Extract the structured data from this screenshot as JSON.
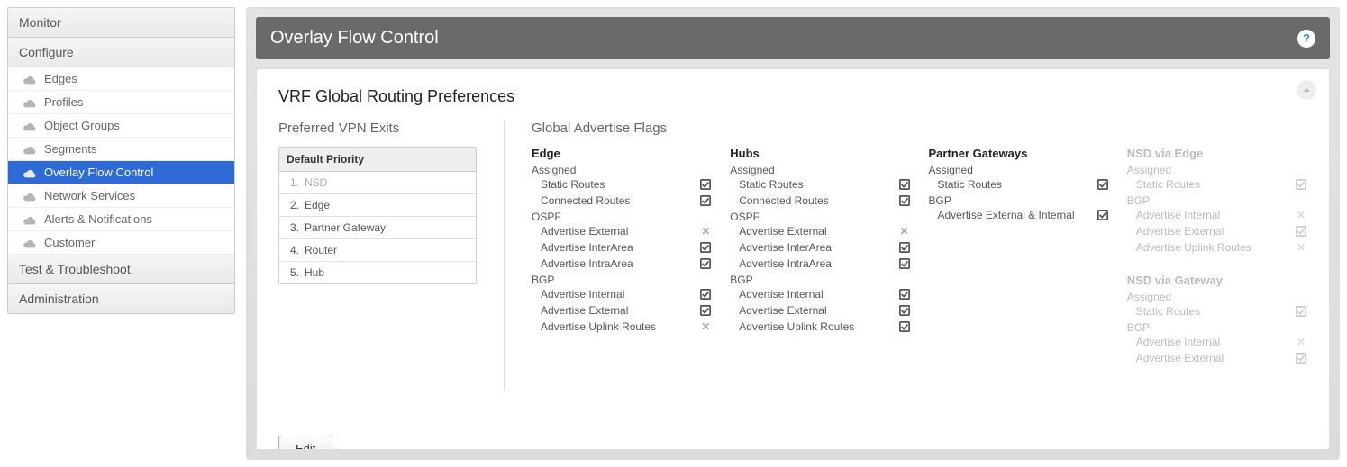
{
  "sidebar": {
    "sections": [
      {
        "label": "Monitor",
        "items": []
      },
      {
        "label": "Configure",
        "items": [
          {
            "label": "Edges"
          },
          {
            "label": "Profiles"
          },
          {
            "label": "Object Groups"
          },
          {
            "label": "Segments"
          },
          {
            "label": "Overlay Flow Control",
            "active": true
          },
          {
            "label": "Network Services"
          },
          {
            "label": "Alerts & Notifications"
          },
          {
            "label": "Customer"
          }
        ]
      },
      {
        "label": "Test & Troubleshoot",
        "items": []
      },
      {
        "label": "Administration",
        "items": []
      }
    ]
  },
  "header": {
    "title": "Overlay Flow Control",
    "help_tooltip": "?"
  },
  "panel": {
    "title": "VRF Global Routing Preferences",
    "preferred_title": "Preferred VPN Exits",
    "gaf_title": "Global Advertise Flags",
    "edit_label": "Edit",
    "priority": {
      "header": "Default Priority",
      "rows": [
        {
          "n": "1.",
          "label": "NSD",
          "dim": true
        },
        {
          "n": "2.",
          "label": "Edge"
        },
        {
          "n": "3.",
          "label": "Partner Gateway"
        },
        {
          "n": "4.",
          "label": "Router"
        },
        {
          "n": "5.",
          "label": "Hub"
        }
      ]
    },
    "gaf": {
      "columns": [
        {
          "title": "Edge",
          "dim": false,
          "groups": [
            {
              "label": "Assigned",
              "rows": [
                {
                  "label": "Static Routes",
                  "on": true
                },
                {
                  "label": "Connected Routes",
                  "on": true
                }
              ]
            },
            {
              "label": "OSPF",
              "rows": [
                {
                  "label": "Advertise External",
                  "on": false
                },
                {
                  "label": "Advertise InterArea",
                  "on": true
                },
                {
                  "label": "Advertise IntraArea",
                  "on": true
                }
              ]
            },
            {
              "label": "BGP",
              "rows": [
                {
                  "label": "Advertise Internal",
                  "on": true
                },
                {
                  "label": "Advertise External",
                  "on": true
                },
                {
                  "label": "Advertise Uplink Routes",
                  "on": false
                }
              ]
            }
          ]
        },
        {
          "title": "Hubs",
          "dim": false,
          "groups": [
            {
              "label": "Assigned",
              "rows": [
                {
                  "label": "Static Routes",
                  "on": true
                },
                {
                  "label": "Connected Routes",
                  "on": true
                }
              ]
            },
            {
              "label": "OSPF",
              "rows": [
                {
                  "label": "Advertise External",
                  "on": false
                },
                {
                  "label": "Advertise InterArea",
                  "on": true
                },
                {
                  "label": "Advertise IntraArea",
                  "on": true
                }
              ]
            },
            {
              "label": "BGP",
              "rows": [
                {
                  "label": "Advertise Internal",
                  "on": true
                },
                {
                  "label": "Advertise External",
                  "on": true
                },
                {
                  "label": "Advertise Uplink Routes",
                  "on": true
                }
              ]
            }
          ]
        },
        {
          "title": "Partner Gateways",
          "dim": false,
          "groups": [
            {
              "label": "Assigned",
              "rows": [
                {
                  "label": "Static Routes",
                  "on": true
                }
              ]
            },
            {
              "label": "BGP",
              "rows": [
                {
                  "label": "Advertise External & Internal",
                  "on": true
                }
              ]
            }
          ]
        },
        {
          "stack": [
            {
              "title": "NSD via Edge",
              "dim": true,
              "groups": [
                {
                  "label": "Assigned",
                  "rows": [
                    {
                      "label": "Static Routes",
                      "on": true
                    }
                  ]
                },
                {
                  "label": "BGP",
                  "rows": [
                    {
                      "label": "Advertise Internal",
                      "on": false
                    },
                    {
                      "label": "Advertise External",
                      "on": true
                    },
                    {
                      "label": "Advertise Uplink Routes",
                      "on": false
                    }
                  ]
                }
              ]
            },
            {
              "title": "NSD via Gateway",
              "dim": true,
              "groups": [
                {
                  "label": "Assigned",
                  "rows": [
                    {
                      "label": "Static Routes",
                      "on": true
                    }
                  ]
                },
                {
                  "label": "BGP",
                  "rows": [
                    {
                      "label": "Advertise Internal",
                      "on": false
                    },
                    {
                      "label": "Advertise External",
                      "on": true
                    }
                  ]
                }
              ]
            }
          ]
        }
      ]
    }
  }
}
